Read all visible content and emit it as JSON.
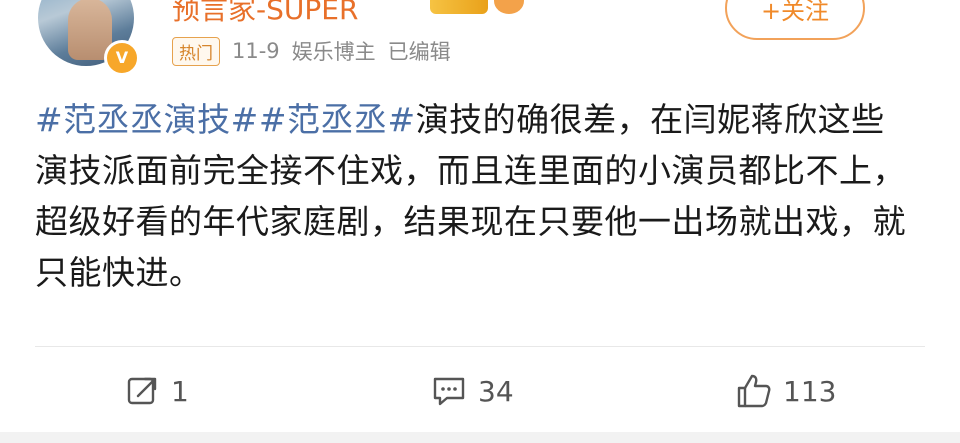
{
  "post": {
    "username": "预言家-SUPER",
    "hot_badge": "热门",
    "date": "11-9",
    "category": "娱乐博主",
    "edited": "已编辑",
    "follow_label": "+关注",
    "hashtag1": "#范丞丞演技#",
    "hashtag2": "#范丞丞#",
    "body": "演技的确很差，在闫妮蒋欣这些演技派面前完全接不住戏，而且连里面的小演员都比不上，超级好看的年代家庭剧，结果现在只要他一出场就出戏，就只能快进。"
  },
  "actions": {
    "share_count": "1",
    "comment_count": "34",
    "like_count": "113"
  },
  "icons": {
    "share": "share-icon",
    "comment": "comment-icon",
    "like": "like-icon",
    "verified": "verified-badge-icon"
  },
  "colors": {
    "hashtag": "#4b6fa6",
    "username": "#e8702a",
    "follow": "#f08a2a"
  }
}
